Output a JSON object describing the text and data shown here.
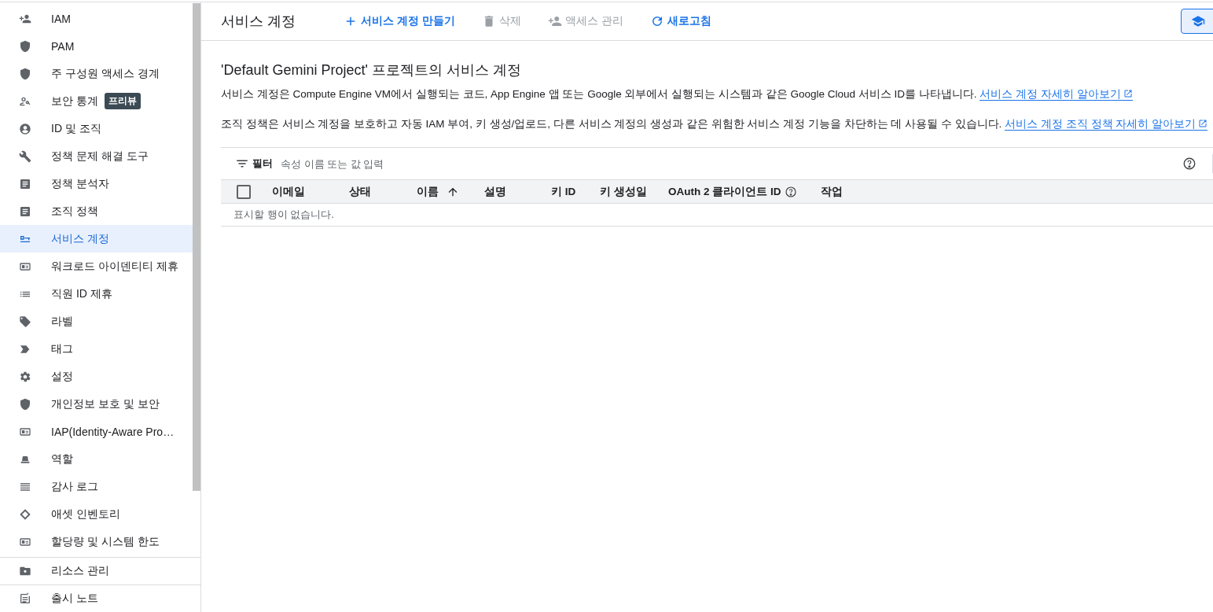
{
  "sidebar": {
    "items": [
      {
        "label": "IAM",
        "selected": false
      },
      {
        "label": "PAM",
        "selected": false
      },
      {
        "label": "주 구성원 액세스 경계",
        "selected": false
      },
      {
        "label": "보안 통계",
        "badge": "프리뷰",
        "selected": false
      },
      {
        "label": "ID 및 조직",
        "selected": false
      },
      {
        "label": "정책 문제 해결 도구",
        "selected": false
      },
      {
        "label": "정책 분석자",
        "selected": false
      },
      {
        "label": "조직 정책",
        "selected": false
      },
      {
        "label": "서비스 계정",
        "selected": true
      },
      {
        "label": "워크로드 아이덴티티 제휴",
        "selected": false
      },
      {
        "label": "직원 ID 제휴",
        "selected": false
      },
      {
        "label": "라벨",
        "selected": false
      },
      {
        "label": "태그",
        "selected": false
      },
      {
        "label": "설정",
        "selected": false
      },
      {
        "label": "개인정보 보호 및 보안",
        "selected": false
      },
      {
        "label": "IAP(Identity-Aware Pro…",
        "selected": false
      },
      {
        "label": "역할",
        "selected": false
      },
      {
        "label": "감사 로그",
        "selected": false
      },
      {
        "label": "애셋 인벤토리",
        "selected": false
      },
      {
        "label": "할당량 및 시스템 한도",
        "selected": false
      }
    ],
    "footer": [
      {
        "label": "리소스 관리"
      },
      {
        "label": "출시 노트"
      }
    ]
  },
  "header": {
    "title": "서비스 계정",
    "actions": [
      {
        "label": "서비스 계정 만들기",
        "disabled": false
      },
      {
        "label": "삭제",
        "disabled": true
      },
      {
        "label": "액세스 관리",
        "disabled": true
      },
      {
        "label": "새로고침",
        "disabled": false
      }
    ]
  },
  "heading": "'Default Gemini Project' 프로젝트의 서비스 계정",
  "paragraphs": [
    {
      "text": "서비스 계정은 Compute Engine VM에서 실행되는 코드, App Engine 앱 또는 Google 외부에서 실행되는 시스템과 같은 Google Cloud 서비스 ID를 나타냅니다.",
      "link": "서비스 계정 자세히 알아보기"
    },
    {
      "text": "조직 정책은 서비스 계정을 보호하고 자동 IAM 부여, 키 생성/업로드, 다른 서비스 계정의 생성과 같은 위험한 서비스 계정 기능을 차단하는 데 사용될 수 있습니다.",
      "link": "서비스 계정 조직 정책 자세히 알아보기"
    }
  ],
  "filter": {
    "label": "필터",
    "placeholder": "속성 이름 또는 값 입력"
  },
  "table": {
    "select_all": {
      "checked": false
    },
    "columns": [
      {
        "label": "이메일",
        "sorted": false,
        "help": false
      },
      {
        "label": "상태",
        "sorted": false,
        "help": false
      },
      {
        "label": "이름",
        "sorted": true,
        "help": false
      },
      {
        "label": "설명",
        "sorted": false,
        "help": false
      },
      {
        "label": "키 ID",
        "sorted": false,
        "help": false
      },
      {
        "label": "키 생성일",
        "sorted": false,
        "help": false
      },
      {
        "label": "OAuth 2 클라이언트 ID",
        "sorted": false,
        "help": true
      },
      {
        "label": "작업",
        "sorted": false,
        "help": false
      }
    ],
    "empty_message": "표시할 행이 없습니다."
  }
}
